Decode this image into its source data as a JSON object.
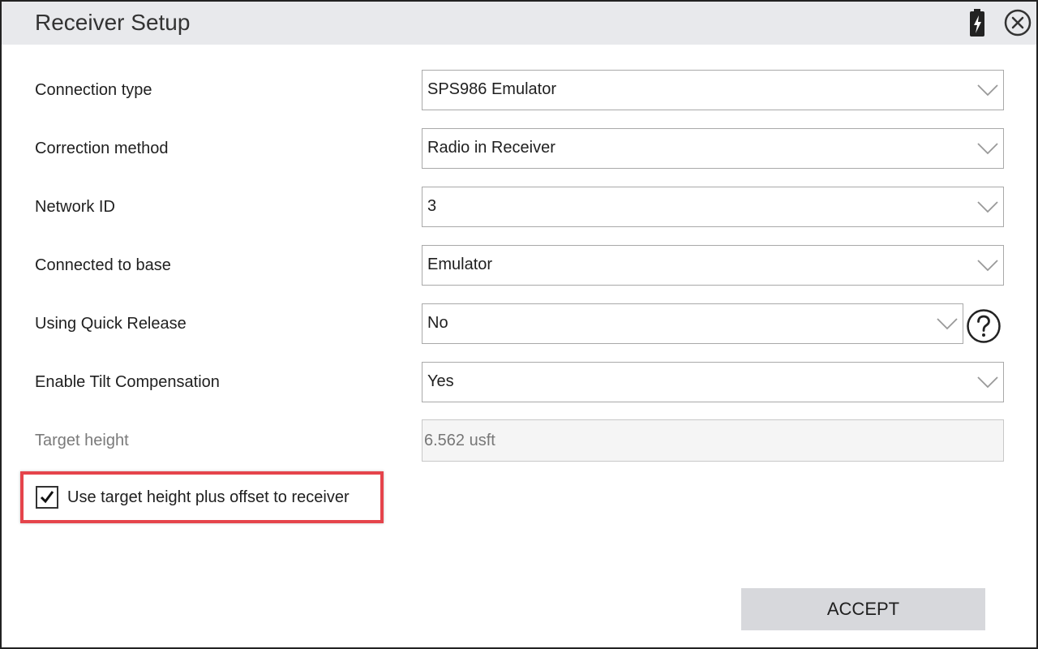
{
  "window": {
    "title": "Receiver Setup",
    "icons": {
      "battery": "battery-charging-icon",
      "close": "close-circle-icon"
    }
  },
  "fields": [
    {
      "label": "Connection type",
      "value": "SPS986 Emulator"
    },
    {
      "label": "Correction method",
      "value": "Radio in Receiver"
    },
    {
      "label": "Network ID",
      "value": "3"
    },
    {
      "label": "Connected to base",
      "value": "Emulator"
    },
    {
      "label": "Using Quick Release",
      "value": "No"
    },
    {
      "label": "Enable Tilt Compensation",
      "value": "Yes"
    }
  ],
  "target_height": {
    "label": "Target height",
    "value": "6.562 usft"
  },
  "option": {
    "label": "Use target height plus offset to receiver",
    "checked": true
  },
  "accept_label": "ACCEPT",
  "colors": {
    "highlight": "#e5444b",
    "titlebar": "#e8e9ec",
    "button": "#d7d8dc"
  }
}
